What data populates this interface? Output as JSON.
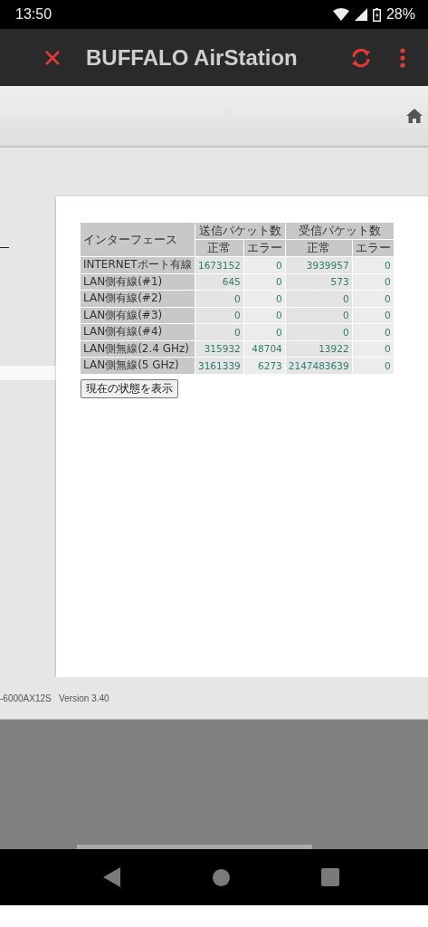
{
  "status_bar": {
    "time": "13:50",
    "battery": "28%"
  },
  "app_bar": {
    "title": "BUFFALO AirStation"
  },
  "table": {
    "corner": "インターフェース",
    "groups": [
      "送信パケット数",
      "受信パケット数"
    ],
    "sub_headers": [
      "正常",
      "エラー",
      "正常",
      "エラー"
    ],
    "rows": [
      {
        "name": "INTERNETポート有線",
        "values": [
          "1673152",
          "0",
          "3939957",
          "0"
        ]
      },
      {
        "name": "LAN側有線(#1)",
        "values": [
          "645",
          "0",
          "573",
          "0"
        ]
      },
      {
        "name": "LAN側有線(#2)",
        "values": [
          "0",
          "0",
          "0",
          "0"
        ]
      },
      {
        "name": "LAN側有線(#3)",
        "values": [
          "0",
          "0",
          "0",
          "0"
        ]
      },
      {
        "name": "LAN側有線(#4)",
        "values": [
          "0",
          "0",
          "0",
          "0"
        ]
      },
      {
        "name": "LAN側無線(2.4 GHz)",
        "values": [
          "315932",
          "48704",
          "13922",
          "0"
        ]
      },
      {
        "name": "LAN側無線(5 GHz)",
        "values": [
          "3161339",
          "6273",
          "2147483639",
          "0"
        ]
      }
    ]
  },
  "refresh_button": "現在の状態を表示",
  "footer": "-6000AX12S   Version 3.40"
}
